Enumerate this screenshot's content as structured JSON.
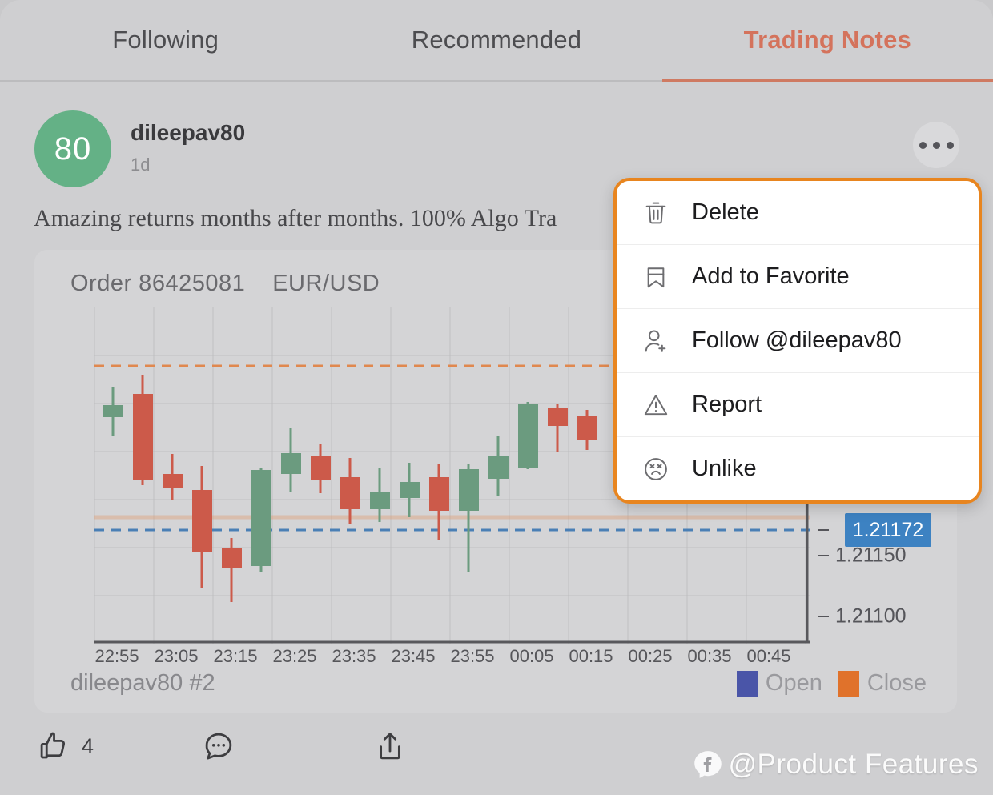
{
  "tabs": [
    {
      "label": "Following",
      "active": false
    },
    {
      "label": "Recommended",
      "active": false
    },
    {
      "label": "Trading Notes",
      "active": true
    }
  ],
  "post": {
    "avatar_text": "80",
    "avatar_color": "#64b186",
    "username": "dileepav80",
    "timestamp": "1d",
    "text": "Amazing returns months after months. 100% Algo Tra",
    "more_icon": "ellipsis-icon"
  },
  "chart_card": {
    "order_label": "Order 86425081",
    "symbol": "EUR/USD",
    "footer_name": "dileepav80 #2",
    "legend": [
      {
        "label": "Open",
        "color": "#4a55a8"
      },
      {
        "label": "Close",
        "color": "#e0722b"
      }
    ],
    "price_badge": "1.21172"
  },
  "actions": {
    "like": {
      "icon": "thumbs-up-icon",
      "count": "4"
    },
    "comment": {
      "icon": "comment-bubble-icon"
    },
    "share": {
      "icon": "share-upload-icon"
    }
  },
  "menu": {
    "accent_color": "#e8851f",
    "items": [
      {
        "label": "Delete",
        "icon": "trash-icon"
      },
      {
        "label": "Add to Favorite",
        "icon": "bookmark-icon"
      },
      {
        "label": "Follow @dileepav80",
        "icon": "person-add-icon"
      },
      {
        "label": "Report",
        "icon": "warning-triangle-icon"
      },
      {
        "label": "Unlike",
        "icon": "sad-face-icon"
      }
    ]
  },
  "watermark": {
    "logo": "f-logo-icon",
    "text": "@Product Features"
  },
  "chart_data": {
    "type": "candlestick",
    "title": "Order 86425081 EUR/USD",
    "xlabel": "",
    "ylabel": "",
    "grid": true,
    "legend_position": "bottom-right",
    "ylim": [
      1.2106,
      1.2126
    ],
    "yticks": [
      1.21172,
      1.2115,
      1.211
    ],
    "ytick_labels": [
      "1.21172",
      "1.21150",
      "1.21100"
    ],
    "categories": [
      "22:55",
      "23:05",
      "23:15",
      "23:25",
      "23:35",
      "23:45",
      "23:55",
      "00:05",
      "00:15",
      "00:25",
      "00:35",
      "00:45"
    ],
    "x_tick_labels": [
      "22:55",
      "23:05",
      "23:15",
      "23:25",
      "23:35",
      "23:45",
      "23:55",
      "00:05",
      "00:15",
      "00:25",
      "00:35",
      "00:45"
    ],
    "reference_lines": [
      {
        "name": "open-line",
        "value": 1.21225,
        "color": "#e0884f",
        "style": "dashed"
      },
      {
        "name": "close-line",
        "value": 1.21172,
        "color": "#4a7fb5",
        "style": "dashed"
      }
    ],
    "colors": {
      "up": "#6b9b7f",
      "down": "#cc5a4a"
    },
    "candles": [
      {
        "t": "22:55",
        "open": 1.212,
        "high": 1.21214,
        "low": 1.21186,
        "close": 1.21205,
        "dir": "up"
      },
      {
        "t": "23:00",
        "open": 1.21208,
        "high": 1.21222,
        "low": 1.21156,
        "close": 1.21161,
        "dir": "down"
      },
      {
        "t": "23:05",
        "open": 1.21167,
        "high": 1.2118,
        "low": 1.2115,
        "close": 1.21162,
        "dir": "down"
      },
      {
        "t": "23:10",
        "open": 1.21163,
        "high": 1.21172,
        "low": 1.21098,
        "close": 1.21122,
        "dir": "down"
      },
      {
        "t": "23:15",
        "open": 1.21132,
        "high": 1.21136,
        "low": 1.21085,
        "close": 1.21124,
        "dir": "down"
      },
      {
        "t": "23:20",
        "open": 1.2112,
        "high": 1.21163,
        "low": 1.21112,
        "close": 1.21163,
        "dir": "up"
      },
      {
        "t": "23:25",
        "open": 1.2117,
        "high": 1.21192,
        "low": 1.21152,
        "close": 1.21178,
        "dir": "up"
      },
      {
        "t": "23:30",
        "open": 1.2118,
        "high": 1.21186,
        "low": 1.21158,
        "close": 1.21172,
        "dir": "down"
      },
      {
        "t": "23:35",
        "open": 1.21168,
        "high": 1.21174,
        "low": 1.2115,
        "close": 1.21158,
        "dir": "down"
      },
      {
        "t": "23:40",
        "open": 1.21156,
        "high": 1.21166,
        "low": 1.21146,
        "close": 1.21159,
        "dir": "up"
      },
      {
        "t": "23:45",
        "open": 1.2116,
        "high": 1.21168,
        "low": 1.2115,
        "close": 1.21166,
        "dir": "up"
      },
      {
        "t": "23:50",
        "open": 1.21168,
        "high": 1.21172,
        "low": 1.2114,
        "close": 1.21158,
        "dir": "down"
      },
      {
        "t": "23:55",
        "open": 1.21158,
        "high": 1.21172,
        "low": 1.21108,
        "close": 1.2117,
        "dir": "up"
      },
      {
        "t": "00:00",
        "open": 1.21168,
        "high": 1.21186,
        "low": 1.21154,
        "close": 1.2118,
        "dir": "up"
      },
      {
        "t": "00:05",
        "open": 1.21178,
        "high": 1.212,
        "low": 1.21172,
        "close": 1.21198,
        "dir": "up"
      },
      {
        "t": "00:10",
        "open": 1.212,
        "high": 1.21202,
        "low": 1.21178,
        "close": 1.21194,
        "dir": "down"
      },
      {
        "t": "00:15",
        "open": 1.21196,
        "high": 1.21198,
        "low": 1.2118,
        "close": 1.21188,
        "dir": "down"
      }
    ]
  }
}
